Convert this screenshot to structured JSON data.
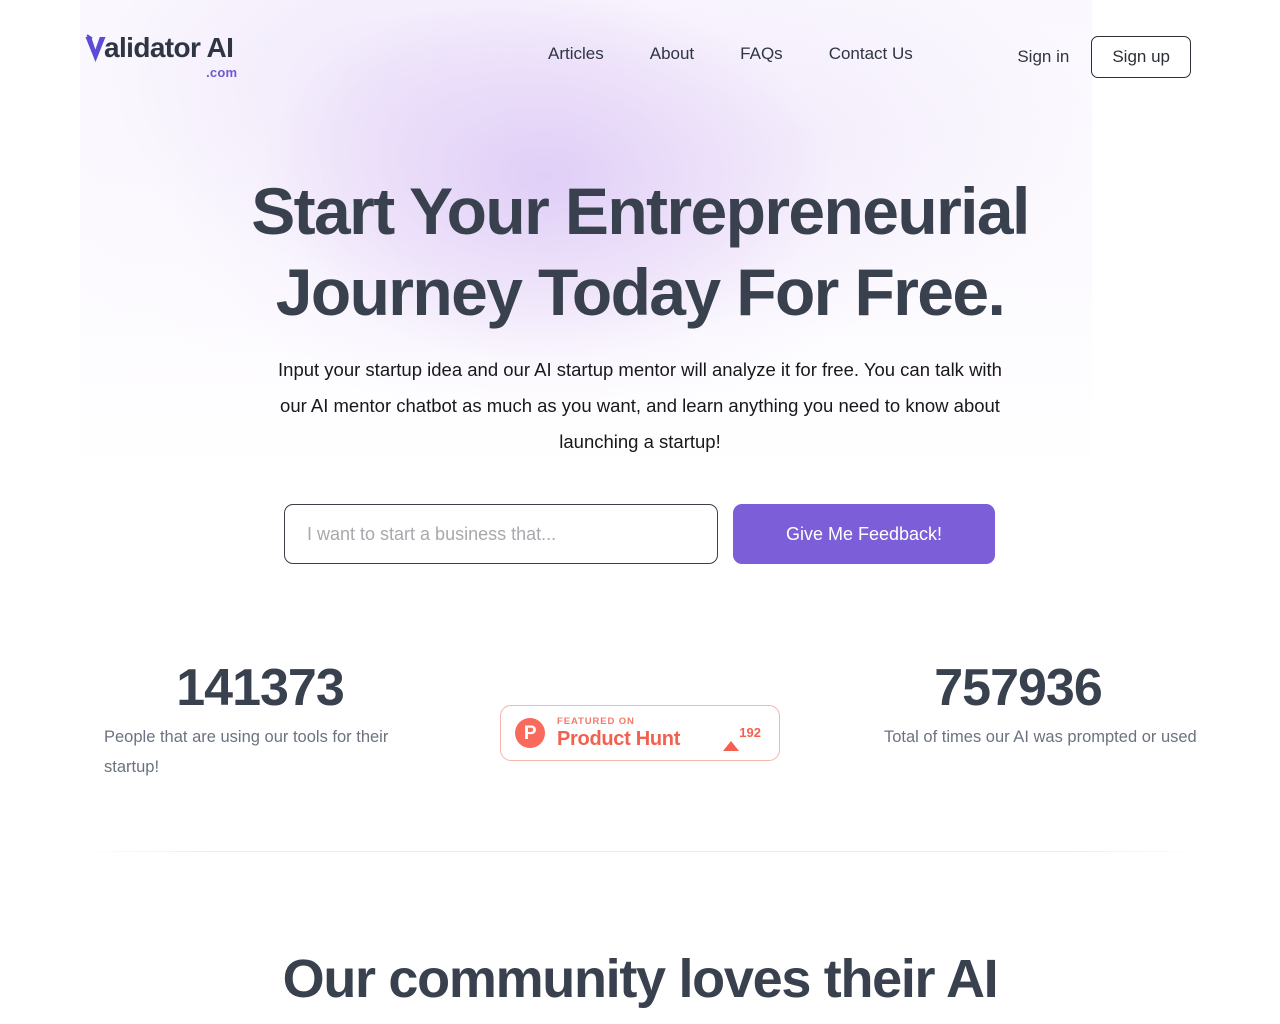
{
  "brand": {
    "name_main": "alidator AI",
    "name_initial": "V",
    "tld": ".com",
    "accent": "#6d5ad1"
  },
  "nav": {
    "items": [
      {
        "label": "Articles"
      },
      {
        "label": "About"
      },
      {
        "label": "FAQs"
      },
      {
        "label": "Contact Us"
      }
    ],
    "signin_label": "Sign in",
    "signup_label": "Sign up"
  },
  "hero": {
    "headline_line1": "Start Your Entrepreneurial",
    "headline_line2": "Journey Today For Free.",
    "subheadline": "Input your startup idea and our AI startup mentor will analyze it for free. You can talk with our AI mentor chatbot as much as you want, and learn anything you need to know about launching a startup!",
    "input_placeholder": "I want to start a business that...",
    "input_value": "",
    "cta_label": "Give Me Feedback!",
    "cta_color": "#7c5fd8"
  },
  "stats": {
    "left": {
      "value": "141373",
      "label": "People that are using our tools for their startup!"
    },
    "right": {
      "value": "757936",
      "label": "Total of times our AI was prompted or used"
    }
  },
  "product_hunt": {
    "featured_label": "FEATURED ON",
    "product_name": "Product Hunt",
    "upvotes": "192",
    "accent": "#f4604f"
  },
  "community": {
    "heading": "Our community loves their AI"
  }
}
